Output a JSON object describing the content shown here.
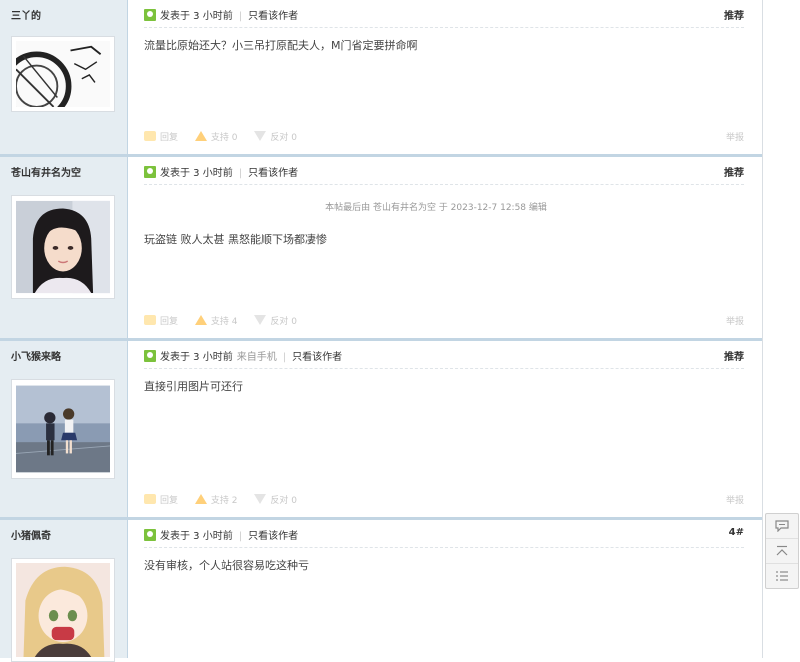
{
  "posts": [
    {
      "author": "三丫的",
      "meta": {
        "posted": "发表于 3 小时前",
        "only_author": "只看该作者",
        "floor": "推荐",
        "device": ""
      },
      "edited": "",
      "content": "流量比原始还大？小三吊打原配夫人，M门省定要拼命啊",
      "actions": {
        "reply": "回复",
        "support": "支持 0",
        "oppose": "反对 0",
        "report": "举报"
      },
      "avatar": "sketch"
    },
    {
      "author": "苍山有井名为空",
      "meta": {
        "posted": "发表于 3 小时前",
        "only_author": "只看该作者",
        "floor": "推荐",
        "device": ""
      },
      "edited": "本帖最后由 苍山有井名为空 于 2023-12-7 12:58 编辑",
      "content": "玩盗链 败人太甚 黑怒能顺下场都凄惨",
      "actions": {
        "reply": "回复",
        "support": "支持 4",
        "oppose": "反对 0",
        "report": "举报"
      },
      "avatar": "girl"
    },
    {
      "author": "小飞猴来略",
      "meta": {
        "posted": "发表于 3 小时前",
        "only_author": "只看该作者",
        "floor": "推荐",
        "device": "来自手机"
      },
      "edited": "",
      "content": "直接引用图片可还行",
      "actions": {
        "reply": "回复",
        "support": "支持 2",
        "oppose": "反对 0",
        "report": "举报"
      },
      "avatar": "anime-couple"
    },
    {
      "author": "小猪佩奇",
      "meta": {
        "posted": "发表于 3 小时前",
        "only_author": "只看该作者",
        "floor": "4#",
        "device": ""
      },
      "edited": "",
      "content": "没有审核，个人站很容易吃这种亏",
      "actions": {
        "reply": "",
        "support": "",
        "oppose": "",
        "report": ""
      },
      "avatar": "anime-girl"
    }
  ],
  "float_tools": [
    "comment-icon",
    "back-to-top-icon",
    "list-icon"
  ]
}
